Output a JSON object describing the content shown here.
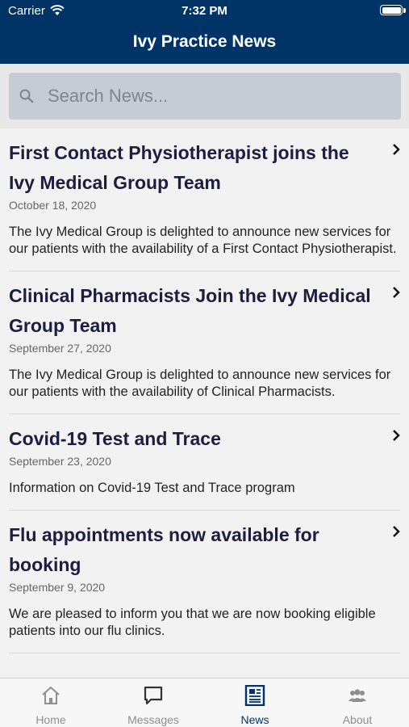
{
  "status": {
    "carrier": "Carrier",
    "time": "7:32 PM"
  },
  "nav": {
    "title": "Ivy Practice News"
  },
  "search": {
    "placeholder": "Search News..."
  },
  "news": [
    {
      "title": "First Contact Physiotherapist joins the Ivy Medical Group Team",
      "date": "October 18, 2020",
      "summary": "The Ivy Medical Group is delighted to announce new services for our patients with the availability of a First Contact Physiotherapist."
    },
    {
      "title": "Clinical Pharmacists Join the Ivy Medical Group Team",
      "date": "September 27, 2020",
      "summary": "The Ivy Medical Group is delighted to announce new services for our patients with the availability of Clinical Pharmacists."
    },
    {
      "title": "Covid-19 Test and Trace",
      "date": "September 23, 2020",
      "summary": "Information on Covid-19 Test and Trace program"
    },
    {
      "title": "Flu appointments now available for booking",
      "date": "September 9, 2020",
      "summary": "We are pleased to inform you that we are now booking eligible patients into our flu clinics."
    }
  ],
  "tabs": [
    {
      "label": "Home",
      "icon": "home-icon"
    },
    {
      "label": "Messages",
      "icon": "chat-icon"
    },
    {
      "label": "News",
      "icon": "newspaper-icon"
    },
    {
      "label": "About",
      "icon": "people-icon"
    }
  ],
  "colors": {
    "nav_bg": "#003366",
    "accent": "#003366",
    "title_text": "#1b1e3f"
  }
}
